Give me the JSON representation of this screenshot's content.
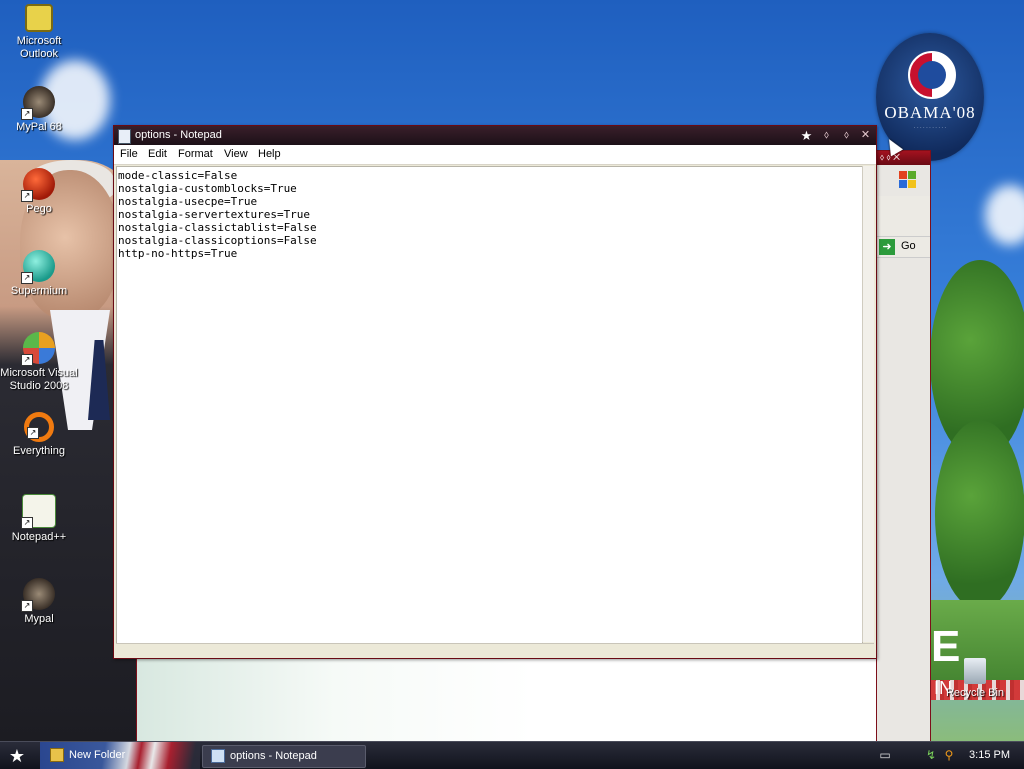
{
  "desktop": {
    "icons": [
      {
        "label": "Microsoft Outlook",
        "icon": "outlook-icon"
      },
      {
        "label": "MyPal 68",
        "icon": "raccoon-icon"
      },
      {
        "label": "Pego",
        "icon": "pego-icon"
      },
      {
        "label": "Supermium",
        "icon": "supermium-icon"
      },
      {
        "label": "Microsoft Visual Studio 2008",
        "icon": "visual-studio-icon"
      },
      {
        "label": "Everything",
        "icon": "everything-search-icon"
      },
      {
        "label": "Notepad++",
        "icon": "notepadpp-icon"
      },
      {
        "label": "Mypal",
        "icon": "raccoon-icon"
      },
      {
        "label": "Recycle Bin",
        "icon": "recycle-bin-icon"
      }
    ],
    "badge": {
      "text": "OBAMA'08"
    }
  },
  "background_window": {
    "go_label": "Go"
  },
  "notepad": {
    "title": "options - Notepad",
    "menu": [
      "File",
      "Edit",
      "Format",
      "View",
      "Help"
    ],
    "lines": [
      "mode-classic=False",
      "nostalgia-customblocks=True",
      "nostalgia-usecpe=True",
      "nostalgia-servertextures=True",
      "nostalgia-classictablist=False",
      "nostalgia-classicoptions=False",
      "http-no-https=True"
    ],
    "buttons": {
      "pin": "★",
      "minimize": "⬨",
      "maximize": "⬨",
      "close": "✕"
    }
  },
  "taskbar": {
    "tasks": [
      {
        "label": "New Folder",
        "icon": "folder-icon"
      },
      {
        "label": "options - Notepad",
        "icon": "notepad-icon"
      }
    ],
    "clock": "3:15 PM"
  }
}
